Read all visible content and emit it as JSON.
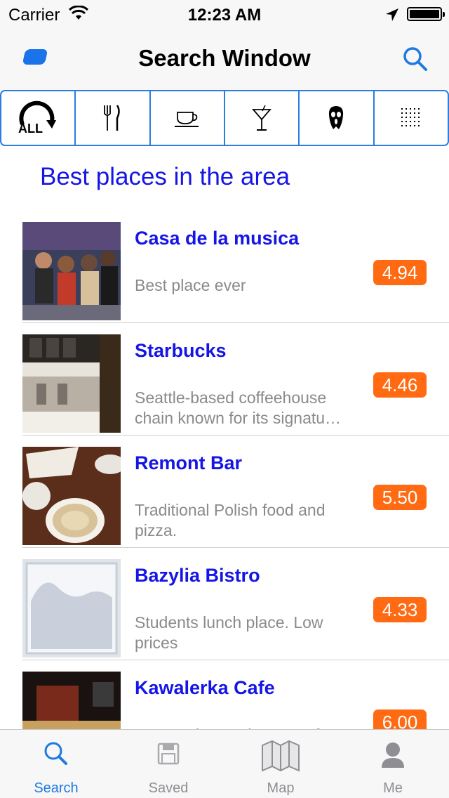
{
  "status_bar": {
    "carrier": "Carrier",
    "time": "12:23 AM"
  },
  "nav": {
    "title": "Search Window"
  },
  "filters": [
    {
      "icon": "all-filter-icon",
      "label": "ALL"
    },
    {
      "icon": "restaurant-icon"
    },
    {
      "icon": "coffee-cup-icon"
    },
    {
      "icon": "cocktail-icon"
    },
    {
      "icon": "ghost-mask-icon"
    },
    {
      "icon": "grid-dots-icon"
    }
  ],
  "section_title": "Best places in the area",
  "places": [
    {
      "name": "Casa de la musica",
      "description": [
        "Best place ever"
      ],
      "rating": "4.94"
    },
    {
      "name": "Starbucks",
      "description": [
        "Seattle-based coffeehouse",
        "chain known for its signatu…"
      ],
      "rating": "4.46"
    },
    {
      "name": "Remont Bar",
      "description": [
        "Traditional Polish food and",
        "pizza."
      ],
      "rating": "5.50"
    },
    {
      "name": "Bazylia Bistro",
      "description": [
        "Students lunch place. Low",
        "prices"
      ],
      "rating": "4.33"
    },
    {
      "name": "Kawalerka Cafe",
      "description": [
        "A cozy place to hang out for"
      ],
      "rating": "6.00"
    }
  ],
  "tabs": [
    {
      "label": "Search",
      "icon": "search-icon",
      "active": true
    },
    {
      "label": "Saved",
      "icon": "floppy-disk-icon",
      "active": false
    },
    {
      "label": "Map",
      "icon": "map-icon",
      "active": false
    },
    {
      "label": "Me",
      "icon": "person-icon",
      "active": false
    }
  ],
  "colors": {
    "accent": "#1f7ae0",
    "title_blue": "#1515e6",
    "rating_orange": "#ff6a12"
  }
}
